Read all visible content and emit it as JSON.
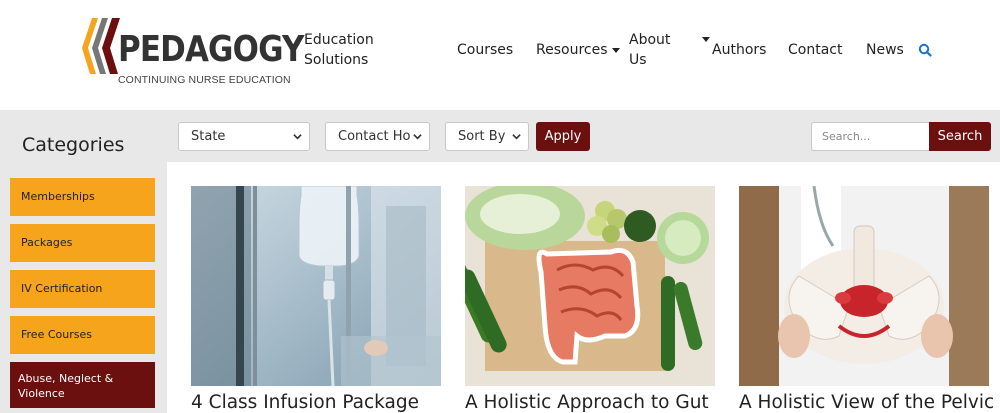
{
  "logo": {
    "wordmark": "PEDAGOGY",
    "subtitle": "CONTINUING NURSE EDUCATION",
    "colors": {
      "mark_dark": "#6b0f0f",
      "mark_gold": "#f7a41d",
      "mark_gray": "#666666"
    }
  },
  "nav": {
    "items": [
      {
        "label": "Education\nSolutions",
        "line1": "Education",
        "line2": "Solutions",
        "dropdown": false
      },
      {
        "label": "Courses",
        "dropdown": false
      },
      {
        "label": "Resources",
        "dropdown": true
      },
      {
        "label": "About Us",
        "line1": "About",
        "line2": "Us",
        "dropdown": true
      },
      {
        "label": "Authors",
        "dropdown": false
      },
      {
        "label": "Contact",
        "dropdown": false
      },
      {
        "label": "News",
        "dropdown": false
      }
    ],
    "search_icon": "search-icon",
    "accent_color": "#1a73c9"
  },
  "filters": {
    "state": "State",
    "contact_hours": "Contact Ho",
    "sort_by": "Sort By",
    "apply_label": "Apply",
    "search_placeholder": "Search...",
    "search_label": "Search",
    "button_color": "#6b0f0f"
  },
  "sidebar": {
    "title": "Categories",
    "items": [
      {
        "label": "Memberships",
        "active": false
      },
      {
        "label": "Packages",
        "active": false
      },
      {
        "label": "IV Certification",
        "active": false
      },
      {
        "label": "Free Courses",
        "active": false
      },
      {
        "label": "Abuse, Neglect & Violence",
        "active": true
      }
    ],
    "item_color": "#f7a41d",
    "active_color": "#6b0f0f"
  },
  "courses": [
    {
      "title": "4 Class Infusion Package",
      "image": "iv-drip-hospital"
    },
    {
      "title": "A Holistic Approach to Gut",
      "image": "gut-vegetables"
    },
    {
      "title": "A Holistic View of the Pelvic",
      "image": "pelvis-model"
    }
  ]
}
